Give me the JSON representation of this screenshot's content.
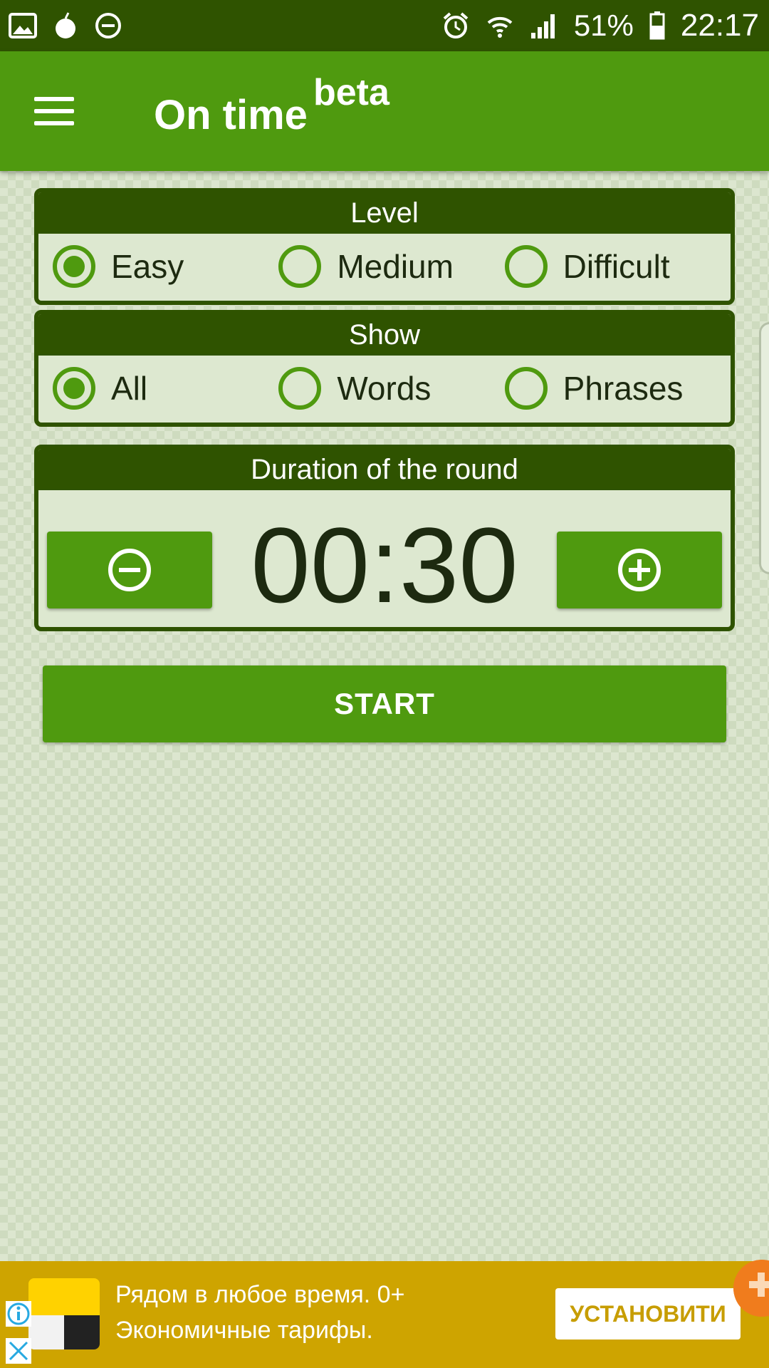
{
  "status_bar": {
    "battery": "51%",
    "time": "22:17",
    "icons_left": [
      "image-icon",
      "apple-icon",
      "do-not-disturb-icon"
    ],
    "icons_right": [
      "alarm-icon",
      "wifi-icon",
      "signal-icon",
      "battery-icon"
    ]
  },
  "app_bar": {
    "title": "On time",
    "badge": "beta"
  },
  "level": {
    "header": "Level",
    "options": [
      {
        "label": "Easy",
        "selected": true
      },
      {
        "label": "Medium",
        "selected": false
      },
      {
        "label": "Difficult",
        "selected": false
      }
    ]
  },
  "show": {
    "header": "Show",
    "options": [
      {
        "label": "All",
        "selected": true
      },
      {
        "label": "Words",
        "selected": false
      },
      {
        "label": "Phrases",
        "selected": false
      }
    ]
  },
  "duration": {
    "header": "Duration of the round",
    "value": "00:30"
  },
  "start_label": "START",
  "ad": {
    "line1": "Рядом в любое время. 0+",
    "line2": "Экономичные тарифы.",
    "install_label": "УСТАНОВИТИ"
  },
  "colors": {
    "primary": "#4f9a0f",
    "dark": "#2f5300",
    "background": "#dce6cf",
    "ad_background": "#cea400"
  }
}
